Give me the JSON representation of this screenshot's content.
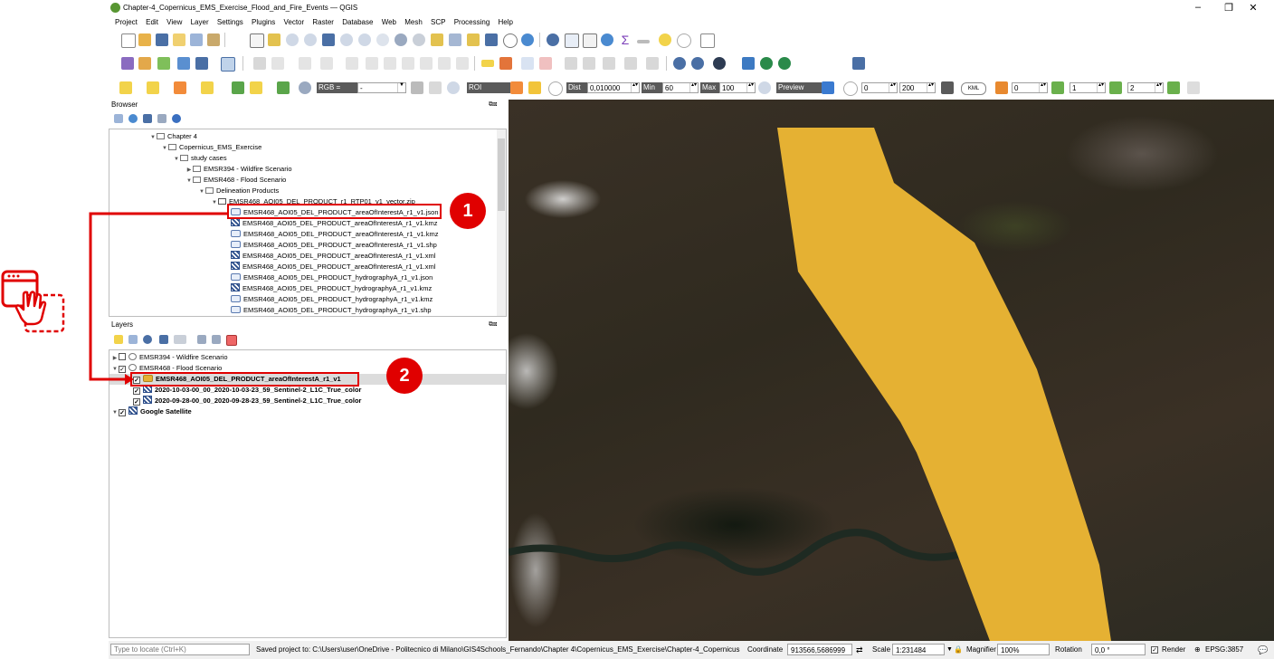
{
  "window": {
    "title": "Chapter-4_Copernicus_EMS_Exercise_Flood_and_Fire_Events — QGIS",
    "minimize": "–",
    "maximize": "❐",
    "close": "✕"
  },
  "menu": [
    "Project",
    "Edit",
    "View",
    "Layer",
    "Settings",
    "Plugins",
    "Vector",
    "Raster",
    "Database",
    "Web",
    "Mesh",
    "SCP",
    "Processing",
    "Help"
  ],
  "scp_toolbar": {
    "rgb_label": "RGB =",
    "rgb_value": "-",
    "roi_label": "ROI",
    "dist_label": "Dist",
    "dist_value": "0,010000",
    "min_label": "Min",
    "min_value": "60",
    "max_label": "Max",
    "max_value": "100",
    "preview_label": "Preview",
    "t_value": "0",
    "s_value": "200",
    "kml_label": "KML",
    "band_a": "0",
    "band_b": "1",
    "band_c": "2"
  },
  "browser": {
    "title": "Browser",
    "items": [
      {
        "label": "Chapter 4",
        "type": "folder",
        "level": 0
      },
      {
        "label": "Copernicus_EMS_Exercise",
        "type": "folder",
        "level": 1
      },
      {
        "label": "study cases",
        "type": "folder",
        "level": 2
      },
      {
        "label": "EMSR394 - Wildfire Scenario",
        "type": "folder",
        "level": 3
      },
      {
        "label": "EMSR468 - Flood Scenario",
        "type": "folder",
        "level": 3
      },
      {
        "label": "Delineation Products",
        "type": "folder",
        "level": 4
      },
      {
        "label": "EMSR468_AOI05_DEL_PRODUCT_r1_RTP01_v1_vector.zip",
        "type": "zip",
        "level": 5
      },
      {
        "label": "EMSR468_AOI05_DEL_PRODUCT_areaOfInterestA_r1_v1.json",
        "type": "vector",
        "level": 6
      },
      {
        "label": "EMSR468_AOI05_DEL_PRODUCT_areaOfInterestA_r1_v1.kmz",
        "type": "raster",
        "level": 6
      },
      {
        "label": "EMSR468_AOI05_DEL_PRODUCT_areaOfInterestA_r1_v1.kmz",
        "type": "vector",
        "level": 6
      },
      {
        "label": "EMSR468_AOI05_DEL_PRODUCT_areaOfInterestA_r1_v1.shp",
        "type": "vector",
        "level": 6
      },
      {
        "label": "EMSR468_AOI05_DEL_PRODUCT_areaOfInterestA_r1_v1.xml",
        "type": "raster",
        "level": 6
      },
      {
        "label": "EMSR468_AOI05_DEL_PRODUCT_areaOfInterestA_r1_v1.xml",
        "type": "raster",
        "level": 6
      },
      {
        "label": "EMSR468_AOI05_DEL_PRODUCT_hydrographyA_r1_v1.json",
        "type": "vector",
        "level": 6
      },
      {
        "label": "EMSR468_AOI05_DEL_PRODUCT_hydrographyA_r1_v1.kmz",
        "type": "raster",
        "level": 6
      },
      {
        "label": "EMSR468_AOI05_DEL_PRODUCT_hydrographyA_r1_v1.kmz",
        "type": "vector",
        "level": 6
      },
      {
        "label": "EMSR468_AOI05_DEL_PRODUCT_hydrographyA_r1_v1.shp",
        "type": "vector",
        "level": 6
      }
    ]
  },
  "layers": {
    "title": "Layers",
    "items": [
      {
        "label": "EMSR394 - Wildfire Scenario",
        "type": "group",
        "checked": false,
        "bold": false
      },
      {
        "label": "EMSR468 - Flood Scenario",
        "type": "group",
        "checked": true,
        "bold": false
      },
      {
        "label": "EMSR468_AOI05_DEL_PRODUCT_areaOfInterestA_r1_v1",
        "type": "vector",
        "checked": true,
        "bold": true
      },
      {
        "label": "2020-10-03-00_00_2020-10-03-23_59_Sentinel-2_L1C_True_color",
        "type": "raster",
        "checked": true,
        "bold": true
      },
      {
        "label": "2020-09-28-00_00_2020-09-28-23_59_Sentinel-2_L1C_True_color",
        "type": "raster",
        "checked": true,
        "bold": true
      },
      {
        "label": "Google Satellite",
        "type": "raster",
        "checked": true,
        "bold": true
      }
    ]
  },
  "annotations": {
    "badge1": "1",
    "badge2": "2"
  },
  "status": {
    "locate_placeholder": "Type to locate (Ctrl+K)",
    "message": "Saved project to: C:\\Users\\user\\OneDrive - Politecnico di Milano\\GIS4Schools_Fernando\\Chapter 4\\Copernicus_EMS_Exercise\\Chapter-4_Copernicus",
    "coordinate_label": "Coordinate",
    "coordinate_value": "913566,5686999",
    "scale_label": "Scale",
    "scale_value": "1:231484",
    "magnifier_label": "Magnifier",
    "magnifier_value": "100%",
    "rotation_label": "Rotation",
    "rotation_value": "0,0 °",
    "render_label": "Render",
    "crs_label": "EPSG:3857"
  },
  "colors": {
    "aoi_fill": "#E5B133",
    "annotation_red": "#E00000",
    "map_base": "#33291F"
  }
}
